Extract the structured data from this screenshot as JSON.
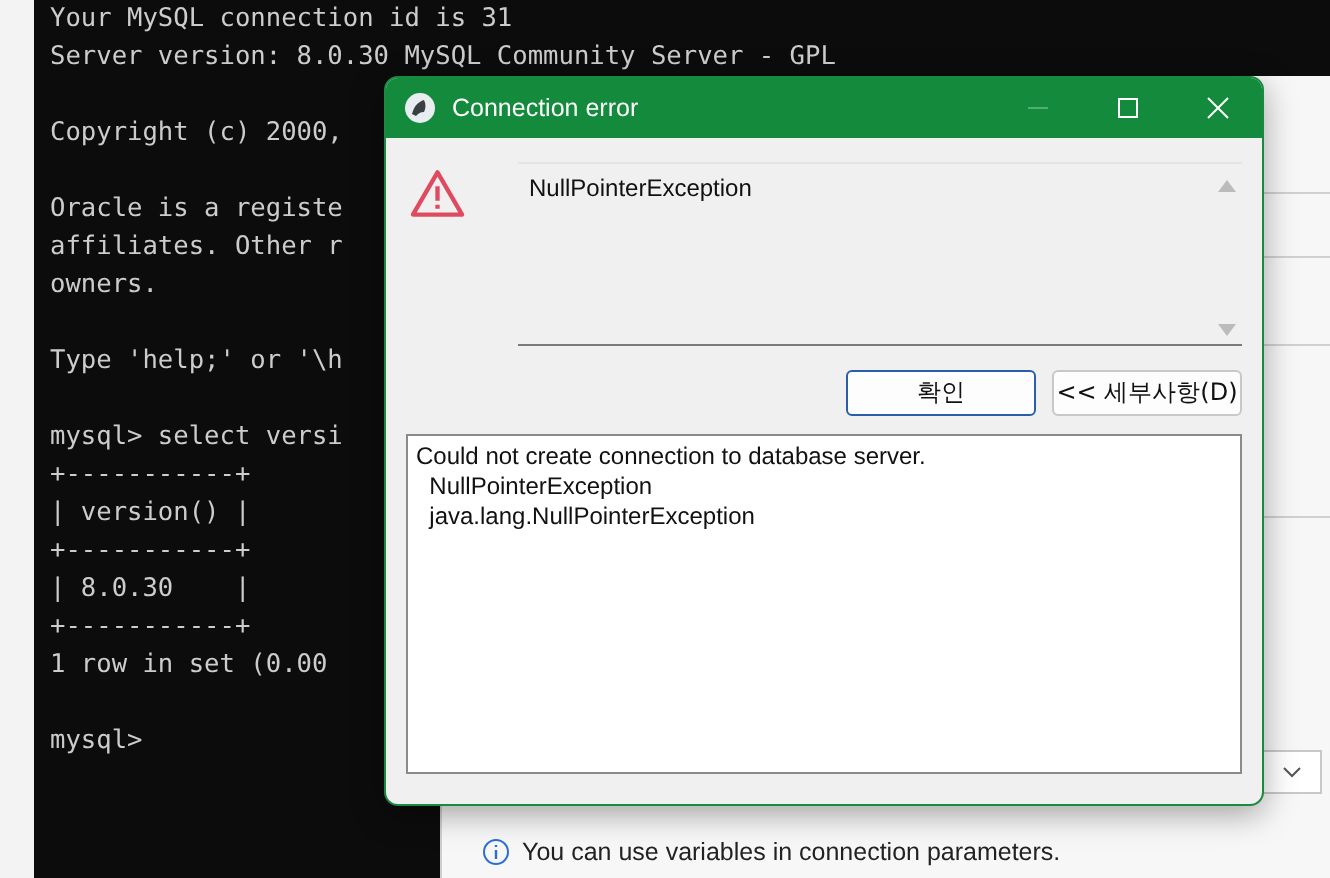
{
  "terminal": {
    "blocks": [
      {
        "lines": [
          "Your MySQL connection id is 31",
          "Server version: 8.0.30 MySQL Community Server - GPL"
        ]
      },
      {
        "lines": [
          "Copyright (c) 2000,"
        ]
      },
      {
        "lines": [
          "Oracle is a registe",
          "affiliates. Other r",
          "owners."
        ]
      },
      {
        "lines": [
          "Type 'help;' or '\\h"
        ]
      },
      {
        "lines": [
          "mysql> select versi",
          "+-----------+",
          "| version() |",
          "+-----------+",
          "| 8.0.30    |",
          "+-----------+",
          "1 row in set (0.00"
        ]
      },
      {
        "lines": [
          "mysql>"
        ]
      }
    ]
  },
  "background_window": {
    "info": "You can use variables in connection parameters."
  },
  "dialog": {
    "title": "Connection error",
    "minimize_disabled": true,
    "message": "NullPointerException",
    "buttons": [
      {
        "label": "확인",
        "default": true
      },
      {
        "label": "<< 세부사항(D)",
        "default": false
      }
    ],
    "details": [
      "Could not create connection to database server.",
      "  NullPointerException",
      "  java.lang.NullPointerException"
    ]
  }
}
